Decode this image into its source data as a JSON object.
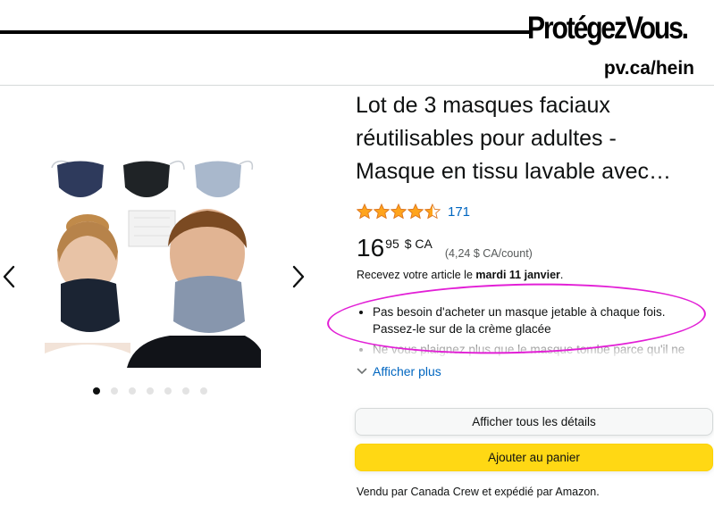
{
  "brand": {
    "logo_text": "ProtégezVous.",
    "url_text": "pv.ca/hein"
  },
  "product": {
    "title": "Lot de 3 masques faciaux réutilisables pour adultes - Masque en tissu lavable avec…",
    "rating": {
      "stars": 4.5,
      "count": "171"
    },
    "price": {
      "whole": "16",
      "fraction": "95",
      "currency": "$ CA",
      "unit_price": "(4,24  $ CA/count)"
    },
    "delivery": {
      "prefix": "Recevez votre article le ",
      "date": "mardi 11 janvier",
      "suffix": "."
    },
    "bullets": [
      "Pas besoin d'acheter un masque jetable à chaque fois. Passez-le sur de la crème glacée",
      "Ne vous plaignez plus que le masque tombe parce qu'il ne"
    ],
    "show_more_label": "Afficher plus"
  },
  "gallery": {
    "dot_count": 7,
    "active_dot": 0,
    "mask_colors": [
      "#2e3a5c",
      "#1f2326",
      "#a9b8cc"
    ]
  },
  "actions": {
    "details_label": "Afficher tous les détails",
    "cart_label": "Ajouter au panier"
  },
  "seller_text": "Vendu par Canada Crew et expédié par Amazon.",
  "colors": {
    "link": "#0066c0",
    "cart_button": "#ffd814",
    "star": "#ffa41c",
    "highlight": "#e21fd6"
  }
}
